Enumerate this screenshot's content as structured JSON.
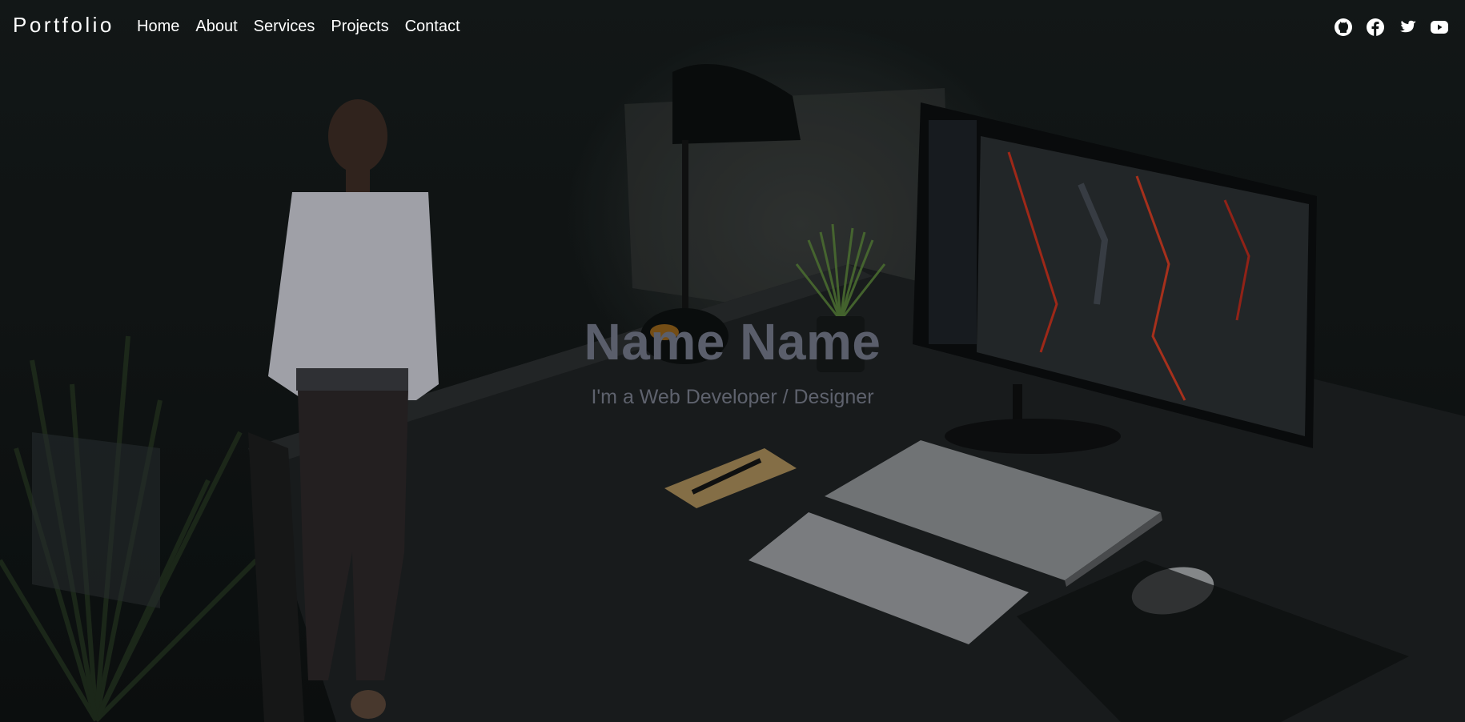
{
  "navbar": {
    "brand": "Portfolio",
    "links": [
      "Home",
      "About",
      "Services",
      "Projects",
      "Contact"
    ],
    "social_icons": [
      "github-icon",
      "facebook-icon",
      "twitter-icon",
      "youtube-icon"
    ]
  },
  "hero": {
    "name": "Name Name",
    "subtitle": "I'm a Web Developer / Designer",
    "background": "dark desk setup photo with person, lamp, plant, monitor, laptop and keyboard"
  },
  "colors": {
    "nav_text": "#ffffff",
    "hero_name": "#5a5e6b",
    "hero_subtitle": "#5e626d",
    "background": "#0f1414"
  }
}
